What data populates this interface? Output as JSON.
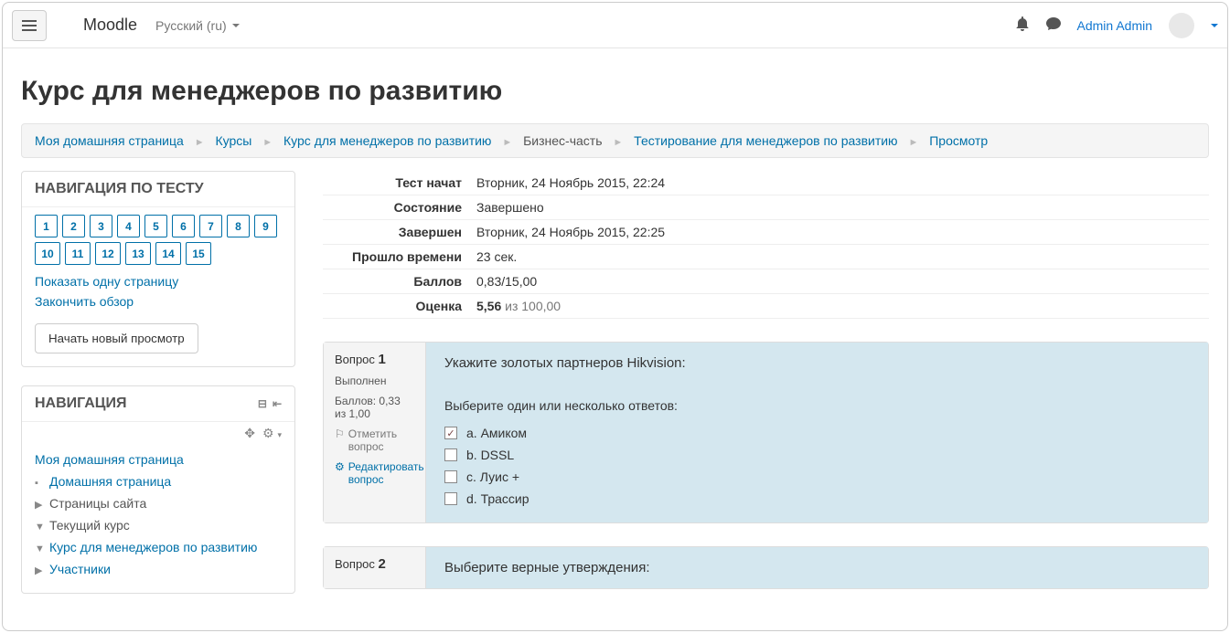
{
  "navbar": {
    "brand": "Moodle",
    "language": "Русский (ru)",
    "user": "Admin Admin"
  },
  "page_title": "Курс для менеджеров по развитию",
  "breadcrumb": [
    {
      "label": "Моя домашняя страница",
      "link": true
    },
    {
      "label": "Курсы",
      "link": true
    },
    {
      "label": "Курс для менеджеров по развитию",
      "link": true
    },
    {
      "label": "Бизнес-часть",
      "link": false
    },
    {
      "label": "Тестирование для менеджеров по развитию",
      "link": true
    },
    {
      "label": "Просмотр",
      "link": true
    }
  ],
  "quiz_nav": {
    "title": "НАВИГАЦИЯ ПО ТЕСТУ",
    "questions": [
      "1",
      "2",
      "3",
      "4",
      "5",
      "6",
      "7",
      "8",
      "9",
      "10",
      "11",
      "12",
      "13",
      "14",
      "15"
    ],
    "show_one_page": "Показать одну страницу",
    "finish_review": "Закончить обзор",
    "new_preview_btn": "Начать новый просмотр"
  },
  "nav_block": {
    "title": "НАВИГАЦИЯ",
    "items": {
      "my_home": "Моя домашняя страница",
      "home": "Домашняя страница",
      "site_pages": "Страницы сайта",
      "current_course": "Текущий курс",
      "course_name": "Курс для менеджеров по развитию",
      "participants": "Участники"
    }
  },
  "summary": {
    "rows": [
      {
        "k": "Тест начат",
        "v": "Вторник, 24 Ноябрь 2015, 22:24"
      },
      {
        "k": "Состояние",
        "v": "Завершено"
      },
      {
        "k": "Завершен",
        "v": "Вторник, 24 Ноябрь 2015, 22:25"
      },
      {
        "k": "Прошло времени",
        "v": "23 сек."
      },
      {
        "k": "Баллов",
        "v": "0,83/15,00"
      }
    ],
    "grade_label": "Оценка",
    "grade_bold": "5,56",
    "grade_rest": " из 100,00"
  },
  "q1": {
    "num_label": "Вопрос",
    "num": "1",
    "status": "Выполнен",
    "mark": "Баллов: 0,33 из 1,00",
    "flag": "Отметить вопрос",
    "edit": "Редактировать вопрос",
    "text": "Укажите золотых партнеров Hikvision:",
    "prompt": "Выберите один или несколько ответов:",
    "options": [
      {
        "label": "a. Амиком",
        "checked": true
      },
      {
        "label": "b. DSSL",
        "checked": false
      },
      {
        "label": "c. Луис +",
        "checked": false
      },
      {
        "label": "d. Трассир",
        "checked": false
      }
    ]
  },
  "q2": {
    "num_label": "Вопрос",
    "num": "2",
    "text": "Выберите верные утверждения:"
  }
}
